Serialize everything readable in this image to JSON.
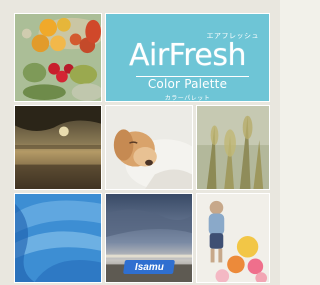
{
  "title": {
    "main": "AirFresh",
    "main_kana": "エアフレッシュ",
    "subtitle": "Color Palette",
    "subtitle_kana": "カラーパレット"
  },
  "logo_text": "Isamu",
  "colors": {
    "title_panel": "#6ec5d6",
    "logo_blue": "#2f6fd0",
    "background": "#f2f1ea"
  }
}
